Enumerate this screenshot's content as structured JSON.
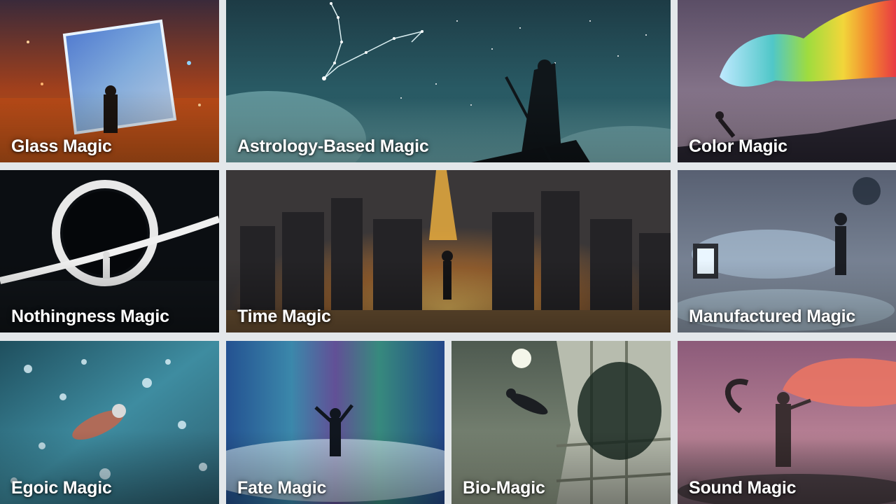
{
  "gallery": {
    "tiles": [
      {
        "label": "Glass Magic"
      },
      {
        "label": "Astrology-Based Magic"
      },
      {
        "label": "Color Magic"
      },
      {
        "label": "Nothingness Magic"
      },
      {
        "label": "Time Magic"
      },
      {
        "label": "Manufactured Magic"
      },
      {
        "label": "Egoic Magic"
      },
      {
        "label": "Fate Magic"
      },
      {
        "label": "Bio-Magic"
      },
      {
        "label": "Sound Magic"
      }
    ]
  }
}
